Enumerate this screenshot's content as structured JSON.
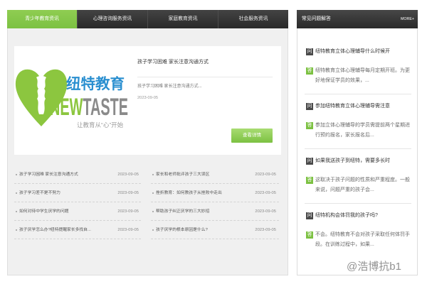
{
  "colors": {
    "accent_green": "#7cc142",
    "logo_green": "#8cc63f",
    "logo_blue": "#2a8fd0",
    "logo_gray": "#8a8a8a",
    "dark_bar": "#2a2a2a",
    "panel_bg": "#f0f0f0"
  },
  "news_tabs": [
    {
      "label": "青少年教育资讯",
      "active": true
    },
    {
      "label": "心理咨询服务资讯",
      "active": false
    },
    {
      "label": "家庭教育资讯",
      "active": false
    },
    {
      "label": "社会服务资讯",
      "active": false
    }
  ],
  "featured": {
    "logo": {
      "icon": "heart-faces-icon",
      "brand_cn": "纽特教育",
      "brand_en_part1": "NEW",
      "brand_en_part2": "TASTE",
      "slogan": "让教育从“心”开始"
    },
    "title": "孩子学习困难 家长注意沟通方式",
    "description": "孩子学习困难 家长注意沟通方式...",
    "date": "2023-09-05",
    "button_label": "查看详情"
  },
  "news_list": {
    "left": [
      {
        "title": "孩子学习困难 家长注意沟通方式",
        "date": "2023-09-05"
      },
      {
        "title": "孩子学习差不是不努力",
        "date": "2023-09-05"
      },
      {
        "title": "如何对待中学生厌学的问题",
        "date": "2023-09-05"
      },
      {
        "title": "孩子厌学怎么办?纽特提醒家长多找自...",
        "date": "2023-09-05"
      }
    ],
    "right": [
      {
        "title": "家长和老师批评孩子三大误区",
        "date": "2023-09-05"
      },
      {
        "title": "挫折教育：如何教孩子从挫败中走出",
        "date": "2023-09-05"
      },
      {
        "title": "帮助孩子纠正厌学的三大妙招",
        "date": "2023-09-05"
      },
      {
        "title": "孩子厌学的根本原因是什么?",
        "date": "2023-09-05"
      }
    ]
  },
  "faq": {
    "title": "常见问题解答",
    "more_label": "MORE+",
    "question_badge": "问",
    "answer_badge": "答",
    "items": [
      {
        "question": "纽特教育立体心理辅导什么时候开",
        "answer": "纽特教育立体心理辅导每月定期开班。为更好地保证学员的效果，..."
      },
      {
        "question": "参加纽特教育立体心理辅导需注意",
        "answer": "参加立体心理辅导的学员需提前两个星期进行预约报名，家长报名后..."
      },
      {
        "question": "如果我送孩子到纽特，需要多长时",
        "answer": "这取决于孩子问题的性质和严重程度。一般来说，问题严重的孩子会..."
      },
      {
        "question": "纽特机构会体罚我的孩子吗?",
        "answer": "不会。纽特教育不会对孩子采取任何体罚手段。在训练过程中，如果..."
      }
    ]
  },
  "watermark": "@浩博抗b1"
}
